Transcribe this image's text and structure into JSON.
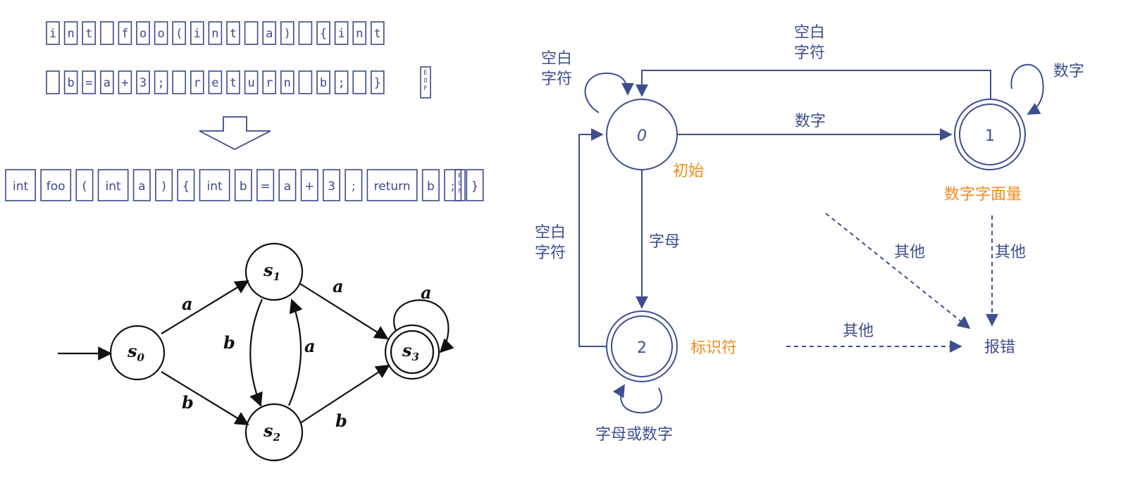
{
  "chars_row1": [
    "i",
    "n",
    "t",
    " ",
    "f",
    "o",
    "o",
    "(",
    "i",
    "n",
    "t",
    " ",
    "a",
    ")",
    " ",
    "{",
    "i",
    "n",
    "t"
  ],
  "chars_row2": [
    " ",
    "b",
    "=",
    "a",
    "+",
    "3",
    ";",
    " ",
    "r",
    "e",
    "t",
    "u",
    "r",
    "n",
    " ",
    "b",
    ";",
    " ",
    "}"
  ],
  "eof_label": "EOF",
  "tokens": [
    "int",
    "foo",
    "(",
    "int",
    "a",
    ")",
    "{",
    "int",
    "b",
    "=",
    "a",
    "+",
    "3",
    ";",
    "return",
    "b",
    ";",
    "}"
  ],
  "dfa": {
    "states": {
      "s0": {
        "main": "s",
        "sub": "0"
      },
      "s1": {
        "main": "s",
        "sub": "1"
      },
      "s2": {
        "main": "s",
        "sub": "2"
      },
      "s3": {
        "main": "s",
        "sub": "3"
      }
    },
    "edges": {
      "s0_s1": "a",
      "s0_s2": "b",
      "s1_s2": "b",
      "s2_s1": "a",
      "s1_s3": "a",
      "s2_s3": "b",
      "s3_loop": "a"
    }
  },
  "lexer": {
    "states": {
      "q0": "0",
      "q1": "1",
      "q2": "2"
    },
    "state_notes": {
      "q0": "初始",
      "q1": "数字字面量",
      "q2": "标识符"
    },
    "error_label": "报错",
    "edges": {
      "q0_loop": [
        "空白",
        "字符"
      ],
      "q1_to_q0": [
        "空白",
        "字符"
      ],
      "q1_loop": "数字",
      "q0_to_q1": "数字",
      "q0_to_q2": "字母",
      "q2_to_q0": [
        "空白",
        "字符"
      ],
      "q2_loop": "字母或数字",
      "q1_err": "其他",
      "mid_err": "其他",
      "q2_err": "其他"
    }
  },
  "colors": {
    "box": "#3b4a8c",
    "diagram": "#3d4f8f",
    "note": "#f08c1c"
  }
}
